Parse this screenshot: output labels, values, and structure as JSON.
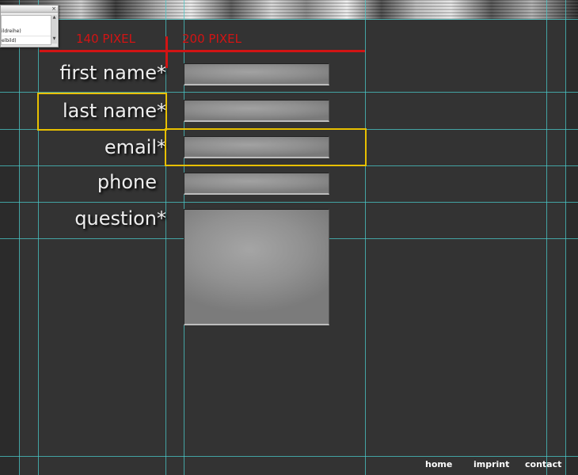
{
  "panel": {
    "rows": [
      "ildreihe)",
      "elbild)"
    ],
    "close_glyph": "×"
  },
  "measurements": {
    "label_column": "140 PIXEL",
    "input_column": "200 PIXEL"
  },
  "form": {
    "fields": [
      {
        "label": "first name*"
      },
      {
        "label": "last name*"
      },
      {
        "label": "email*"
      },
      {
        "label": "phone"
      },
      {
        "label": "question*"
      }
    ]
  },
  "footer": {
    "links": [
      "home",
      "imprint",
      "contact"
    ]
  },
  "colors": {
    "background": "#333333",
    "guide": "#49c9c9",
    "measure": "#d21414",
    "highlight": "#e8c000"
  }
}
